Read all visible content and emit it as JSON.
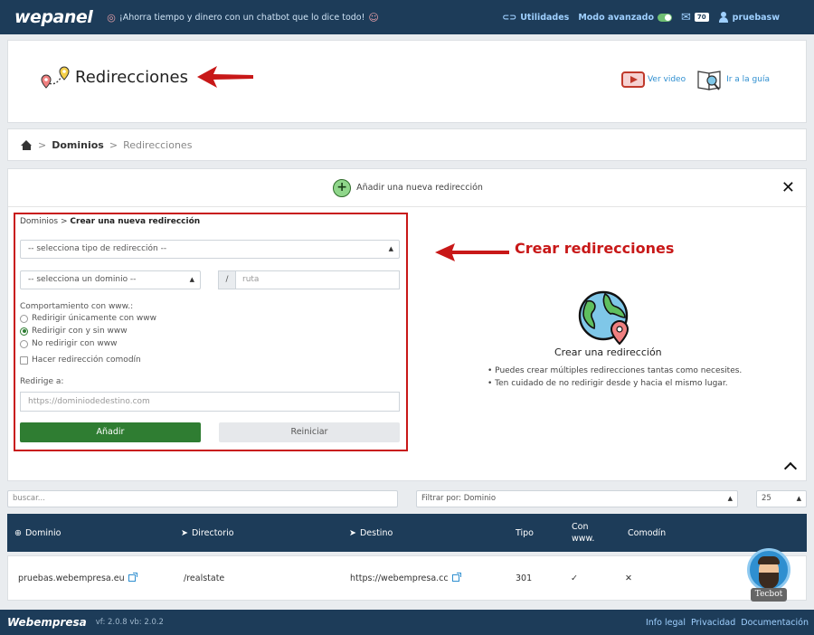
{
  "topbar": {
    "logo": "wepanel",
    "promo": "¡Ahorra tiempo y dinero con un chatbot que lo dice todo!",
    "utilities": "Utilidades",
    "advanced_mode": "Modo avanzado",
    "mail_count": "70",
    "username": "pruebasw"
  },
  "header": {
    "title": "Redirecciones",
    "video_link": "Ver video",
    "guide_link": "Ir a la guía"
  },
  "breadcrumb": {
    "sep1": ">",
    "item1": "Dominios",
    "sep2": ">",
    "item2": "Redirecciones"
  },
  "form": {
    "add_header": "Añadir una nueva redirección",
    "crumb_parent": "Dominios",
    "crumb_sep": ">",
    "crumb_current": "Crear una nueva redirección",
    "type_select": "-- selecciona tipo de redirección --",
    "domain_select": "-- selecciona un dominio --",
    "slash": "/",
    "route_placeholder": "ruta",
    "www_label": "Comportamiento con www.:",
    "radio1": "Redirigir únicamente con www",
    "radio2": "Redirigir con y sin www",
    "radio3": "No redirigir con www",
    "wildcard": "Hacer redirección comodín",
    "redirect_to": "Redirige a:",
    "dest_placeholder": "https://dominiodedestino.com",
    "add_button": "Añadir",
    "reset_button": "Reiniciar"
  },
  "annotation": "Crear redirecciones",
  "info": {
    "title": "Crear una redirección",
    "bullet1": "Puedes crear múltiples redirecciones tantas como necesites.",
    "bullet2": "Ten cuidado de no redirigir desde y hacia el mismo lugar."
  },
  "filters": {
    "search_placeholder": "buscar...",
    "filter_select": "Filtrar por: Dominio",
    "page_size": "25"
  },
  "table": {
    "columns": [
      "Dominio",
      "Directorio",
      "Destino",
      "Tipo",
      "Con www.",
      "Comodín"
    ],
    "rows": [
      {
        "domain": "pruebas.webempresa.eu",
        "directory": "/realstate",
        "destination": "https://webempresa.cc",
        "type": "301",
        "www": "✓",
        "wildcard": "✕"
      }
    ]
  },
  "tecbot": "Tecbot",
  "footer": {
    "logo": "Webempresa",
    "version": "vf: 2.0.8 vb: 2.0.2",
    "legal": "Info legal",
    "privacy": "Privacidad",
    "docs": "Documentación"
  }
}
